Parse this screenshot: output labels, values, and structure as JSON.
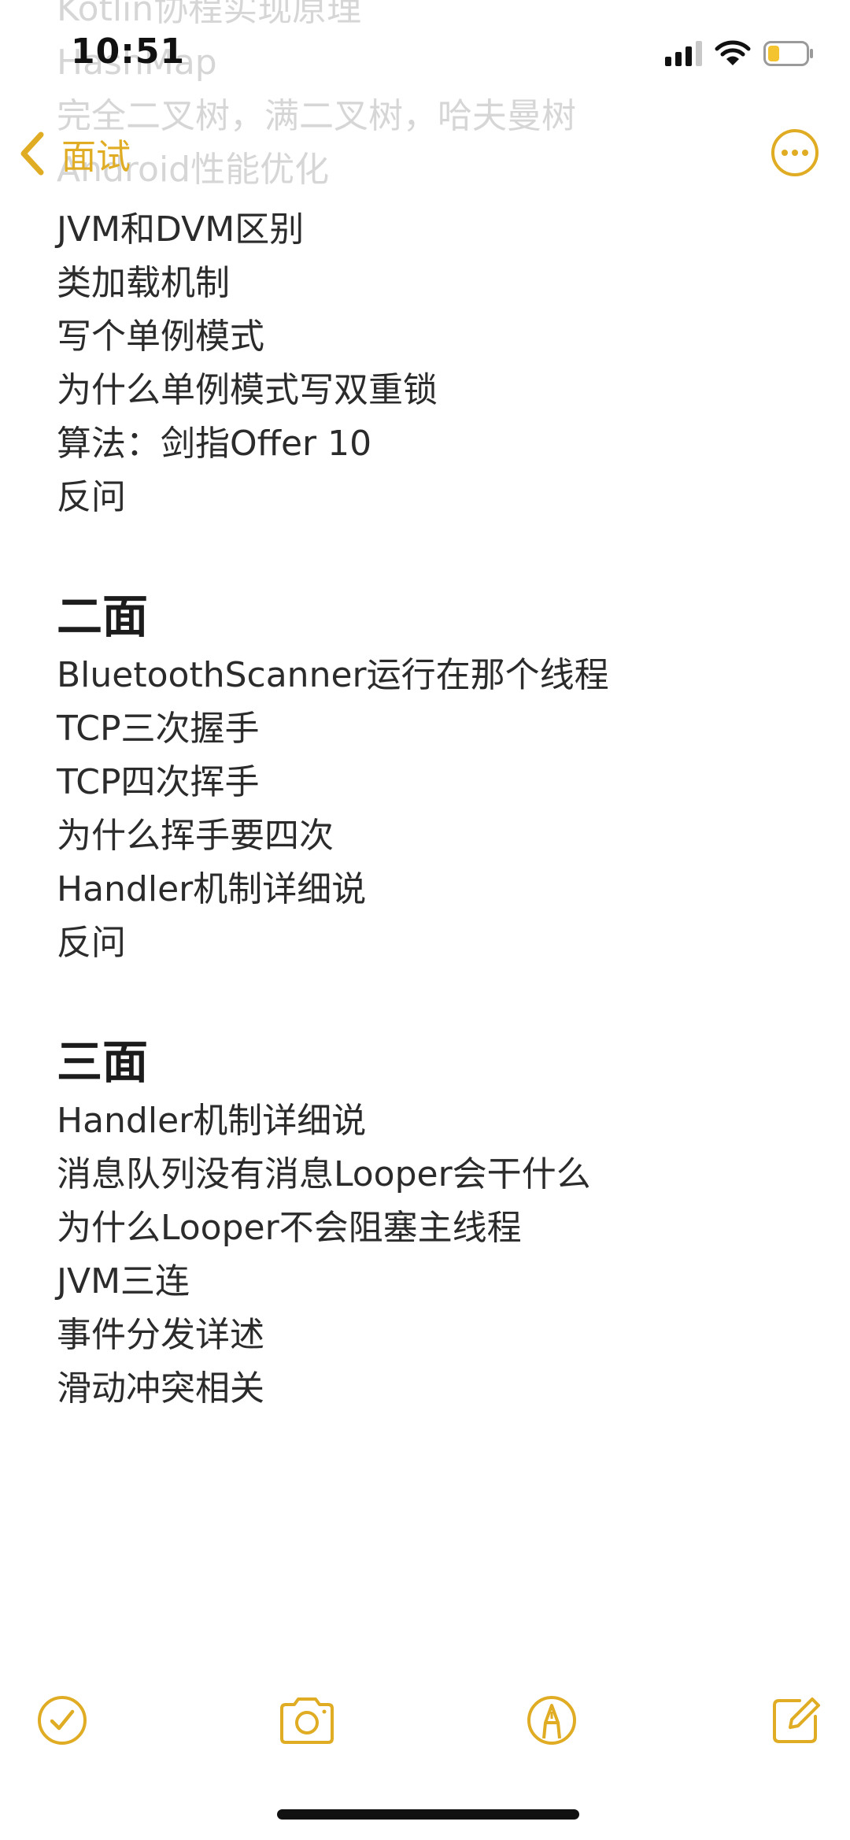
{
  "status_bar": {
    "time": "10:51",
    "signal_icon": "cellular-signal-icon",
    "wifi_icon": "wifi-icon",
    "battery_icon": "battery-low-icon",
    "battery_level": 0.3
  },
  "nav": {
    "back_label": "面试",
    "accent_color": "#e0ac23"
  },
  "scrolled_under": [
    "Kotlin协程实现原理",
    "HashMap",
    "完全二叉树，满二叉树，哈夫曼树",
    "Android性能优化"
  ],
  "note": {
    "section1_lines": [
      "JVM和DVM区别",
      "类加载机制",
      "写个单例模式",
      "为什么单例模式写双重锁",
      "算法：剑指Offer 10",
      "反问"
    ],
    "section2_title": "二面",
    "section2_lines": [
      "BluetoothScanner运行在那个线程",
      "TCP三次握手",
      "TCP四次挥手",
      "为什么挥手要四次",
      "Handler机制详细说",
      "反问"
    ],
    "section3_title": "三面",
    "section3_lines": [
      "Handler机制详细说",
      "消息队列没有消息Looper会干什么",
      "为什么Looper不会阻塞主线程",
      "JVM三连",
      "事件分发详述",
      "滑动冲突相关"
    ]
  },
  "toolbar": {
    "items": [
      "checklist-icon",
      "camera-icon",
      "markup-pen-icon",
      "compose-icon"
    ]
  }
}
